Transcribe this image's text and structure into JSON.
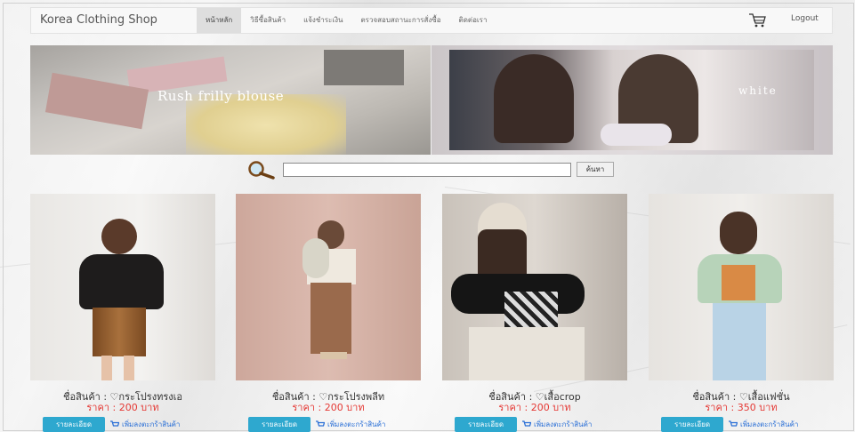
{
  "header": {
    "brand": "Korea Clothing Shop",
    "nav": [
      "หน้าหลัก",
      "วิธีซื้อสินค้า",
      "แจ้งชำระเงิน",
      "ตรวจสอบสถานะการสั่งซื้อ",
      "ติดต่อเรา"
    ],
    "active_index": 0,
    "cart_icon": "cart-icon",
    "logout_label": "Logout"
  },
  "banners": {
    "left_text": "Rush frilly blouse",
    "right_text": "white"
  },
  "search": {
    "value": "",
    "button_label": "ค้นหา"
  },
  "products": [
    {
      "name": "ชื่อสินค้า : ♡กระโปรงทรงเอ",
      "price": "ราคา : 200 บาท",
      "detail_label": "รายละเอียด",
      "add_label": "เพิ่มลงตะกร้าสินค้า"
    },
    {
      "name": "ชื่อสินค้า : ♡กระโปรงพลีท",
      "price": "ราคา : 200 บาท",
      "detail_label": "รายละเอียด",
      "add_label": "เพิ่มลงตะกร้าสินค้า"
    },
    {
      "name": "ชื่อสินค้า : ♡เสื้อcrop",
      "price": "ราคา : 200 บาท",
      "detail_label": "รายละเอียด",
      "add_label": "เพิ่มลงตะกร้าสินค้า"
    },
    {
      "name": "ชื่อสินค้า : ♡เสื้อแฟชั่น",
      "price": "ราคา : 350 บาท",
      "detail_label": "รายละเอียด",
      "add_label": "เพิ่มลงตะกร้าสินค้า"
    }
  ],
  "colors": {
    "price": "#e53935",
    "detail_button": "#2ea8cf",
    "add_link": "#2a6fd6"
  }
}
